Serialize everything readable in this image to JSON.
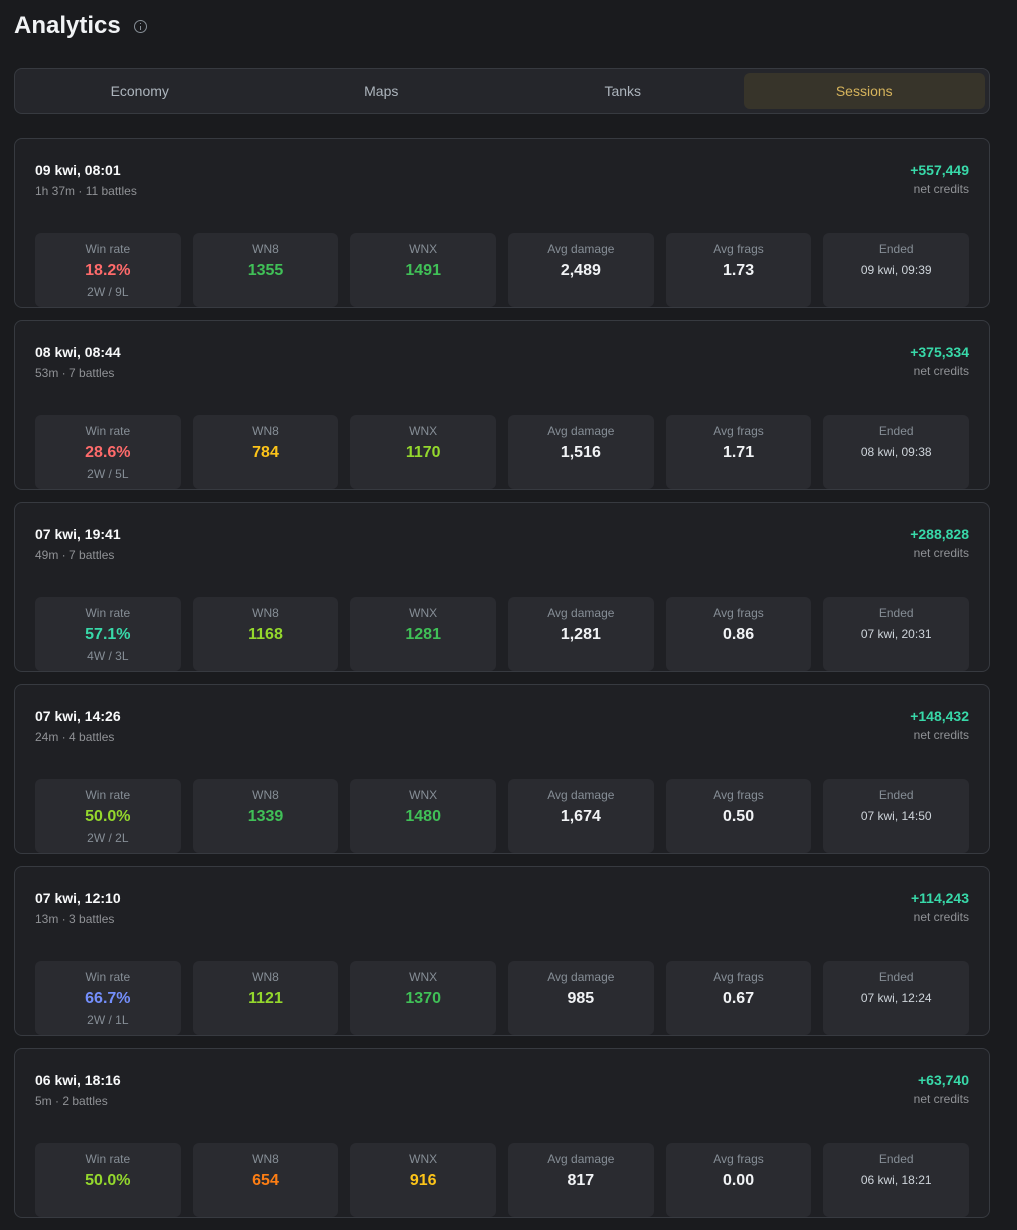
{
  "page": {
    "title": "Analytics"
  },
  "tabs": [
    {
      "label": "Economy",
      "active": false
    },
    {
      "label": "Maps",
      "active": false
    },
    {
      "label": "Tanks",
      "active": false
    },
    {
      "label": "Sessions",
      "active": true
    }
  ],
  "labels": {
    "win_rate": "Win rate",
    "wn8": "WN8",
    "wnx": "WNX",
    "avg_damage": "Avg damage",
    "avg_frags": "Avg frags",
    "ended": "Ended",
    "net_credits": "net credits"
  },
  "colors": {
    "red": "#ff6b6b",
    "green": "#40c057",
    "teal": "#38d9a9",
    "lime": "#94d82d",
    "yellow": "#fcc419",
    "orange": "#fd7e14",
    "indigo": "#748ffc",
    "white": "#f1f3f5"
  },
  "sessions": [
    {
      "date": "09 kwi, 08:01",
      "meta": "1h 37m · 11 battles",
      "credits": "+557,449",
      "win_rate": "18.2%",
      "win_rate_color": "red",
      "record": "2W / 9L",
      "wn8": "1355",
      "wn8_color": "green",
      "wnx": "1491",
      "wnx_color": "green",
      "avg_damage": "2,489",
      "avg_frags": "1.73",
      "ended": "09 kwi, 09:39"
    },
    {
      "date": "08 kwi, 08:44",
      "meta": "53m · 7 battles",
      "credits": "+375,334",
      "win_rate": "28.6%",
      "win_rate_color": "red",
      "record": "2W / 5L",
      "wn8": "784",
      "wn8_color": "yellow",
      "wnx": "1170",
      "wnx_color": "lime",
      "avg_damage": "1,516",
      "avg_frags": "1.71",
      "ended": "08 kwi, 09:38"
    },
    {
      "date": "07 kwi, 19:41",
      "meta": "49m · 7 battles",
      "credits": "+288,828",
      "win_rate": "57.1%",
      "win_rate_color": "teal",
      "record": "4W / 3L",
      "wn8": "1168",
      "wn8_color": "lime",
      "wnx": "1281",
      "wnx_color": "green",
      "avg_damage": "1,281",
      "avg_frags": "0.86",
      "ended": "07 kwi, 20:31"
    },
    {
      "date": "07 kwi, 14:26",
      "meta": "24m · 4 battles",
      "credits": "+148,432",
      "win_rate": "50.0%",
      "win_rate_color": "lime",
      "record": "2W / 2L",
      "wn8": "1339",
      "wn8_color": "green",
      "wnx": "1480",
      "wnx_color": "green",
      "avg_damage": "1,674",
      "avg_frags": "0.50",
      "ended": "07 kwi, 14:50"
    },
    {
      "date": "07 kwi, 12:10",
      "meta": "13m · 3 battles",
      "credits": "+114,243",
      "win_rate": "66.7%",
      "win_rate_color": "indigo",
      "record": "2W / 1L",
      "wn8": "1121",
      "wn8_color": "lime",
      "wnx": "1370",
      "wnx_color": "green",
      "avg_damage": "985",
      "avg_frags": "0.67",
      "ended": "07 kwi, 12:24"
    },
    {
      "date": "06 kwi, 18:16",
      "meta": "5m · 2 battles",
      "credits": "+63,740",
      "win_rate": "50.0%",
      "win_rate_color": "lime",
      "record": "",
      "wn8": "654",
      "wn8_color": "orange",
      "wnx": "916",
      "wnx_color": "yellow",
      "avg_damage": "817",
      "avg_frags": "0.00",
      "ended": "06 kwi, 18:21"
    }
  ]
}
